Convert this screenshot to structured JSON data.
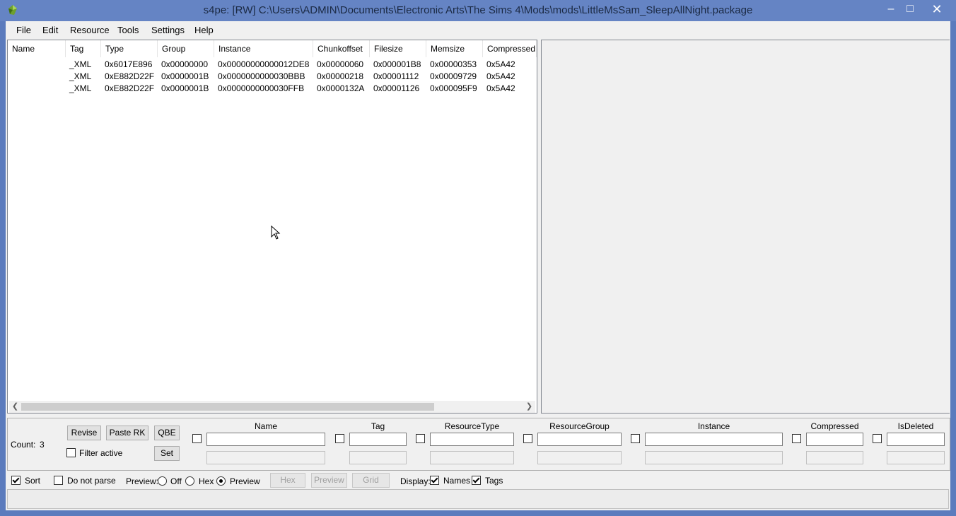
{
  "window": {
    "title": "s4pe: [RW] C:\\Users\\ADMIN\\Documents\\Electronic Arts\\The Sims 4\\Mods\\mods\\LittleMsSam_SleepAllNight.package",
    "minimize": "–",
    "maximize": "□",
    "close": "✕"
  },
  "menu": [
    "File",
    "Edit",
    "Resource",
    "Tools",
    "Settings",
    "Help"
  ],
  "list": {
    "columns": [
      "Name",
      "Tag",
      "Type",
      "Group",
      "Instance",
      "Chunkoffset",
      "Filesize",
      "Memsize",
      "Compressed"
    ],
    "rows": [
      {
        "name": "",
        "tag": "_XML",
        "type": "0x6017E896",
        "group": "0x00000000",
        "instance": "0x00000000000012DE8",
        "chunkoffset": "0x00000060",
        "filesize": "0x000001B8",
        "memsize": "0x00000353",
        "compressed": "0x5A42"
      },
      {
        "name": "",
        "tag": "_XML",
        "type": "0xE882D22F",
        "group": "0x0000001B",
        "instance": "0x0000000000030BBB",
        "chunkoffset": "0x00000218",
        "filesize": "0x00001112",
        "memsize": "0x00009729",
        "compressed": "0x5A42"
      },
      {
        "name": "",
        "tag": "_XML",
        "type": "0xE882D22F",
        "group": "0x0000001B",
        "instance": "0x0000000000030FFB",
        "chunkoffset": "0x0000132A",
        "filesize": "0x00001126",
        "memsize": "0x000095F9",
        "compressed": "0x5A42"
      }
    ]
  },
  "filter": {
    "count_label": "Count:",
    "count_value": "3",
    "revise": "Revise",
    "paste_rk": "Paste RK",
    "qbe": "QBE",
    "set": "Set",
    "filter_active": "Filter active",
    "columns": [
      "Name",
      "Tag",
      "ResourceType",
      "ResourceGroup",
      "Instance",
      "Compressed",
      "IsDeleted"
    ]
  },
  "options": {
    "sort": "Sort",
    "do_not_parse": "Do not parse",
    "preview_label": "Preview:",
    "off": "Off",
    "hex": "Hex",
    "preview": "Preview",
    "btn_hex": "Hex",
    "btn_preview": "Preview",
    "btn_grid": "Grid",
    "display_label": "Display:",
    "names": "Names",
    "tags": "Tags"
  }
}
